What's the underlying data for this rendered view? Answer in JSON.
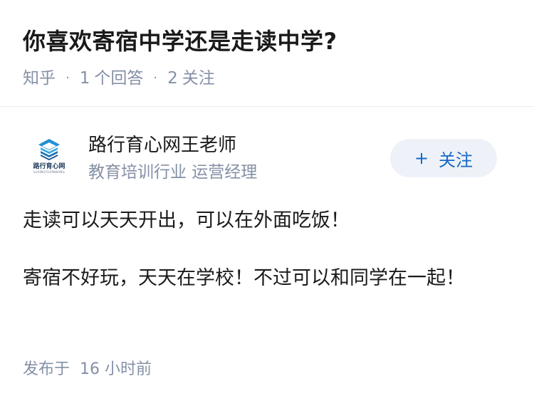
{
  "question": {
    "title": "你喜欢寄宿中学还是走读中学?",
    "source": "知乎",
    "answer_count": "1",
    "answer_label": "个回答",
    "follow_count": "2",
    "follow_label": "关注"
  },
  "author": {
    "name": "路行育心网王老师",
    "description": "教育培训行业 运营经理",
    "avatar_logo_text": "路行育心网",
    "avatar_logo_sub": "LUXINGYUXINWANG",
    "avatar_icon": "building-logo-icon",
    "follow_button_label": "关注",
    "follow_button_icon": "+"
  },
  "answer": {
    "paragraphs": [
      "走读可以天天开出，可以在外面吃饭！",
      "寄宿不好玩，天天在学校！不过可以和同学在一起！"
    ],
    "published_label": "发布于",
    "published_time": "16 小时前"
  },
  "colors": {
    "accent": "#1767c4",
    "meta_gray": "#8590a6",
    "follow_bg": "#eef2f8",
    "text": "#1a1a1a"
  }
}
